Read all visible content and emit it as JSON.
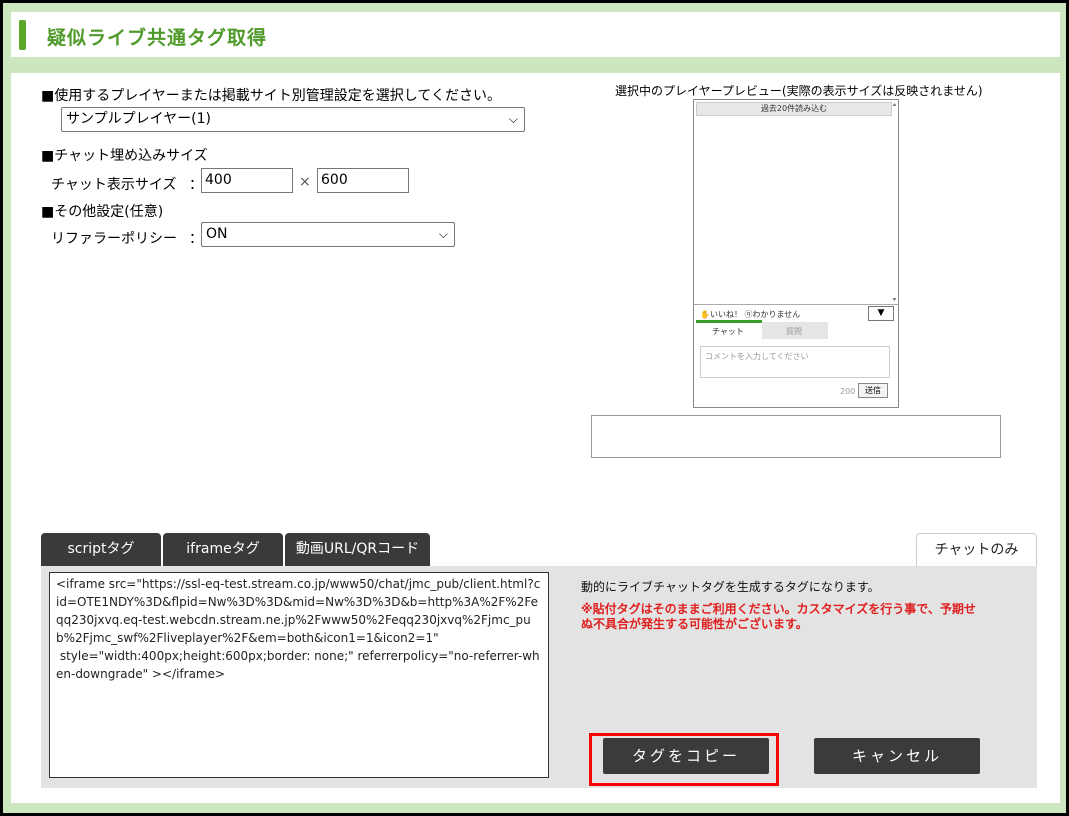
{
  "header": {
    "title": "疑似ライブ共通タグ取得"
  },
  "settings": {
    "player_section": "■使用するプレイヤーまたは掲載サイト別管理設定を選択してください。",
    "player_select": "サンプルプレイヤー(1)",
    "size_section": "■チャット埋め込みサイズ",
    "size_label": "チャット表示サイズ",
    "colon": "：",
    "width": "400",
    "times": "×",
    "height": "600",
    "other_section": "■その他設定(任意)",
    "referrer_label": "リファラーポリシー",
    "referrer_select": "ON"
  },
  "preview": {
    "caption": "選択中のプレイヤープレビュー(実際の表示サイズは反映されません)",
    "load_more": "過去20件読み込む",
    "like": "いいね！",
    "unknown": "わかりません",
    "tab_chat": "チャット",
    "tab_question": "質問",
    "comment_placeholder": "コメントを入力してください",
    "char_count": "200",
    "send": "送信"
  },
  "tabs": {
    "script": "scriptタグ",
    "iframe": "iframeタグ",
    "video_url": "動画URL/QRコード",
    "chat_only": "チャットのみ"
  },
  "code": "<iframe src=\"https://ssl-eq-test.stream.co.jp/www50/chat/jmc_pub/client.html?cid=OTE1NDY%3D&flpid=Nw%3D%3D&mid=Nw%3D%3D&b=http%3A%2F%2Feqq230jxvq.eq-test.webcdn.stream.ne.jp%2Fwww50%2Feqq230jxvq%2Fjmc_pub%2Fjmc_swf%2Fliveplayer%2F&em=both&icon1=1&icon2=1\"\n style=\"width:400px;height:600px;border: none;\" referrerpolicy=\"no-referrer-when-downgrade\" ></iframe>",
  "description": "動的にライブチャットタグを生成するタグになります。",
  "warning": "※貼付タグはそのままご利用ください。カスタマイズを行う事で、予期せぬ不具合が発生する可能性がございます。",
  "buttons": {
    "copy": "タグをコピー",
    "cancel": "キャンセル"
  },
  "colors": {
    "accent": "#5aa52a",
    "header_text": "#4f9a2a",
    "frame_bg": "#cde6c0",
    "tab_dark": "#3a3a3a",
    "warning": "#e02020",
    "highlight": "#ff0000"
  }
}
